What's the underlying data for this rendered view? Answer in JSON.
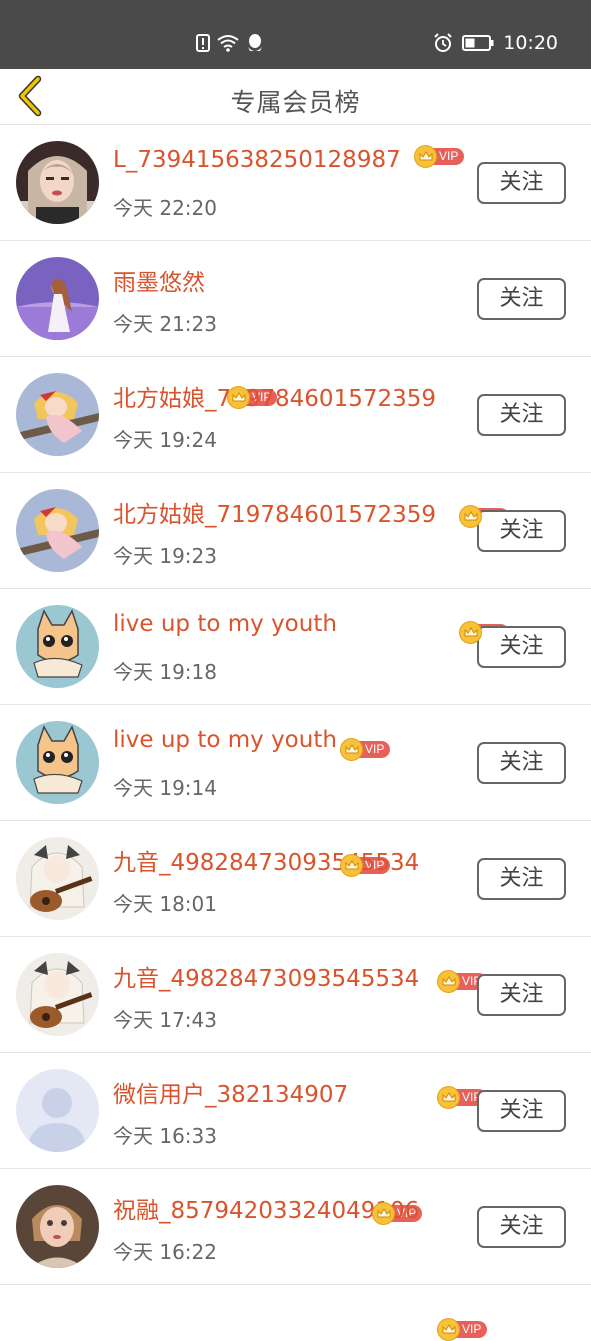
{
  "status_bar": {
    "time": "10:20",
    "icons": [
      "alert-icon",
      "wifi-icon",
      "qq-icon",
      "alarm-icon",
      "battery-icon"
    ]
  },
  "header": {
    "title": "专属会员榜",
    "back_icon": "chevron-left-icon"
  },
  "colors": {
    "name": "#d9542c",
    "vip_crown": "#f7c23a",
    "vip_tag": "#e8605a",
    "back_arrow": "#e6b800"
  },
  "members": [
    {
      "name": "L_739415638250128987",
      "time": "今天 22:20",
      "vip": "VIP",
      "follow_label": "关注",
      "avatar": "girl-photo"
    },
    {
      "name": "雨墨悠然",
      "time": "今天 21:23",
      "vip": "VIP",
      "follow_label": "关注",
      "avatar": "lavender-field"
    },
    {
      "name": "北方姑娘_719784601572359",
      "time": "今天 19:24",
      "vip": "VIP",
      "follow_label": "关注",
      "avatar": "anime-witch"
    },
    {
      "name": "北方姑娘_719784601572359",
      "time": "今天 19:23",
      "vip": "VIP",
      "follow_label": "关注",
      "avatar": "anime-witch"
    },
    {
      "name": "live up to my youth",
      "time": "今天 19:18",
      "vip": "VIP",
      "follow_label": "关注",
      "avatar": "cartoon-cat"
    },
    {
      "name": "live up to my youth",
      "time": "今天 19:14",
      "vip": "VIP",
      "follow_label": "关注",
      "avatar": "cartoon-cat"
    },
    {
      "name": "九音_49828473093545534",
      "time": "今天 18:01",
      "vip": "VIP",
      "follow_label": "关注",
      "avatar": "anime-guitar"
    },
    {
      "name": "九音_49828473093545534",
      "time": "今天 17:43",
      "vip": "VIP",
      "follow_label": "关注",
      "avatar": "anime-guitar"
    },
    {
      "name": "微信用户_382134907",
      "time": "今天 16:33",
      "vip": "VIP",
      "follow_label": "关注",
      "avatar": "default-user"
    },
    {
      "name": "祝融_85794203324049106",
      "time": "今天 16:22",
      "vip": "VIP",
      "follow_label": "关注",
      "avatar": "doll-photo"
    }
  ]
}
